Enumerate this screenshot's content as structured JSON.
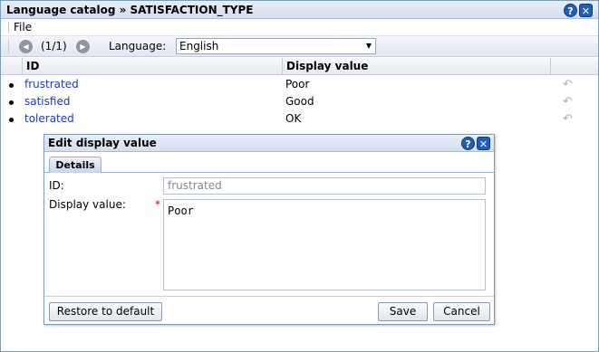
{
  "window": {
    "title": "Language catalog » SATISFACTION_TYPE",
    "help_label": "?",
    "close_label": "✕"
  },
  "menu": {
    "file": "File"
  },
  "toolbar": {
    "prev_icon": "◀",
    "next_icon": "▶",
    "pager": "(1/1)",
    "language_label": "Language:",
    "language_value": "English",
    "dropdown_arrow": "▼"
  },
  "grid": {
    "columns": [
      "ID",
      "Display value"
    ],
    "rows": [
      {
        "id": "frustrated",
        "value": "Poor"
      },
      {
        "id": "satisfied",
        "value": "Good"
      },
      {
        "id": "tolerated",
        "value": "OK"
      }
    ],
    "restore_icon": "↶"
  },
  "dialog": {
    "title": "Edit display value",
    "help_label": "?",
    "close_label": "✕",
    "tab": "Details",
    "id_label": "ID:",
    "id_value": "frustrated",
    "display_label": "Display value:",
    "required_mark": "*",
    "display_value": "Poor",
    "restore_button": "Restore to default",
    "save_button": "Save",
    "cancel_button": "Cancel"
  }
}
